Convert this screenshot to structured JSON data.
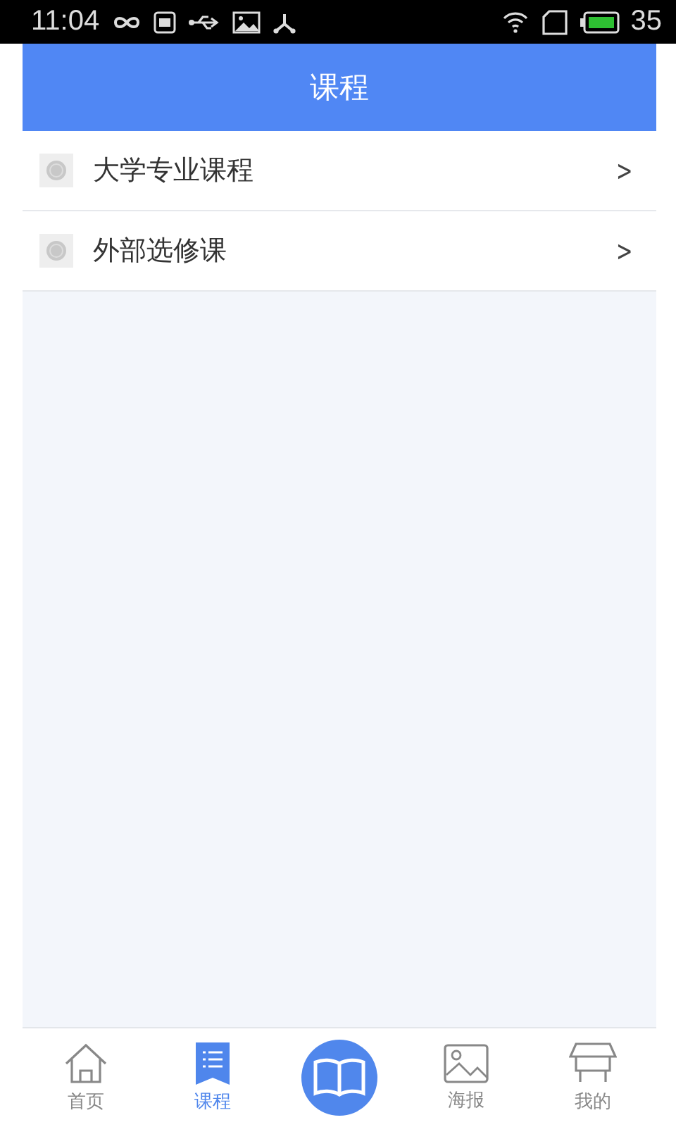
{
  "status_bar": {
    "time": "11:04",
    "battery": "35"
  },
  "header": {
    "title": "课程"
  },
  "items": [
    {
      "label": "大学专业课程",
      "chevron": ">"
    },
    {
      "label": "外部选修课",
      "chevron": ">"
    }
  ],
  "tabs": [
    {
      "kind": "home",
      "label": "首页",
      "selected": false
    },
    {
      "kind": "list",
      "label": "课程",
      "selected": true
    },
    {
      "kind": "book",
      "selected": false
    },
    {
      "kind": "image",
      "label": "海报",
      "selected": false
    },
    {
      "kind": "profile",
      "label": "我的",
      "selected": false
    }
  ]
}
